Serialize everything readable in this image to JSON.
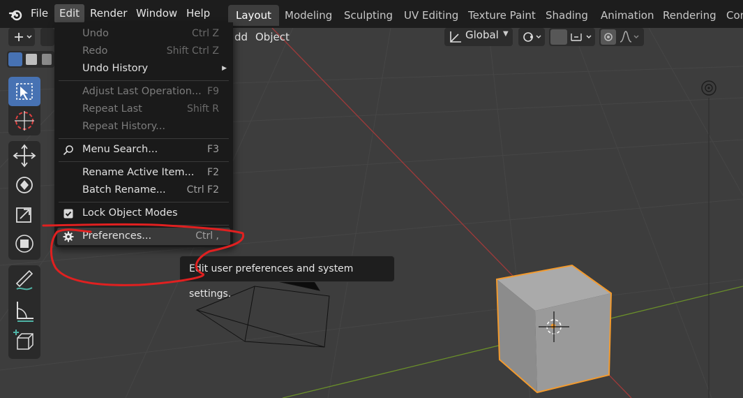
{
  "menubar": {
    "items": [
      "File",
      "Edit",
      "Render",
      "Window",
      "Help"
    ],
    "active": "Edit"
  },
  "workspaces": {
    "tabs": [
      "Layout",
      "Modeling",
      "Sculpting",
      "UV Editing",
      "Texture Paint",
      "Shading",
      "Animation",
      "Rendering",
      "Con"
    ],
    "active": "Layout"
  },
  "viewport_header": {
    "add_label": "dd",
    "object_label": "Object",
    "orientation_label": "Global"
  },
  "edit_menu": {
    "items": [
      {
        "label": "Undo",
        "shortcut": "Ctrl Z",
        "enabled": false
      },
      {
        "label": "Redo",
        "shortcut": "Shift Ctrl Z",
        "enabled": false
      },
      {
        "label": "Undo History",
        "shortcut": "",
        "enabled": true,
        "submenu": true
      },
      {
        "label": "Adjust Last Operation...",
        "shortcut": "F9",
        "enabled": false
      },
      {
        "label": "Repeat Last",
        "shortcut": "Shift R",
        "enabled": false
      },
      {
        "label": "Repeat History...",
        "shortcut": "",
        "enabled": false
      },
      {
        "label": "Menu Search...",
        "shortcut": "F3",
        "enabled": true,
        "icon": "search-icon"
      },
      {
        "label": "Rename Active Item...",
        "shortcut": "F2",
        "enabled": true
      },
      {
        "label": "Batch Rename...",
        "shortcut": "Ctrl F2",
        "enabled": true
      },
      {
        "label": "Lock Object Modes",
        "shortcut": "",
        "enabled": true,
        "icon": "checkbox-checked-icon",
        "checked": true
      },
      {
        "label": "Preferences...",
        "shortcut": "Ctrl ,",
        "enabled": true,
        "icon": "gear-icon",
        "highlighted": true
      }
    ]
  },
  "tooltip": {
    "text": "Edit user preferences and system settings."
  },
  "toolbar": {
    "tools": [
      "select-box-tool",
      "cursor-tool",
      "move-tool",
      "rotate-tool",
      "scale-tool",
      "transform-tool",
      "annotate-tool",
      "measure-tool",
      "add-cube-tool"
    ],
    "active": "select-box-tool"
  },
  "colors": {
    "accent": "#4772b3",
    "selection_outline": "#f29a2e",
    "annotation_red": "#e02020",
    "x_axis": "#a03a3a",
    "y_axis": "#6a8f2a"
  }
}
